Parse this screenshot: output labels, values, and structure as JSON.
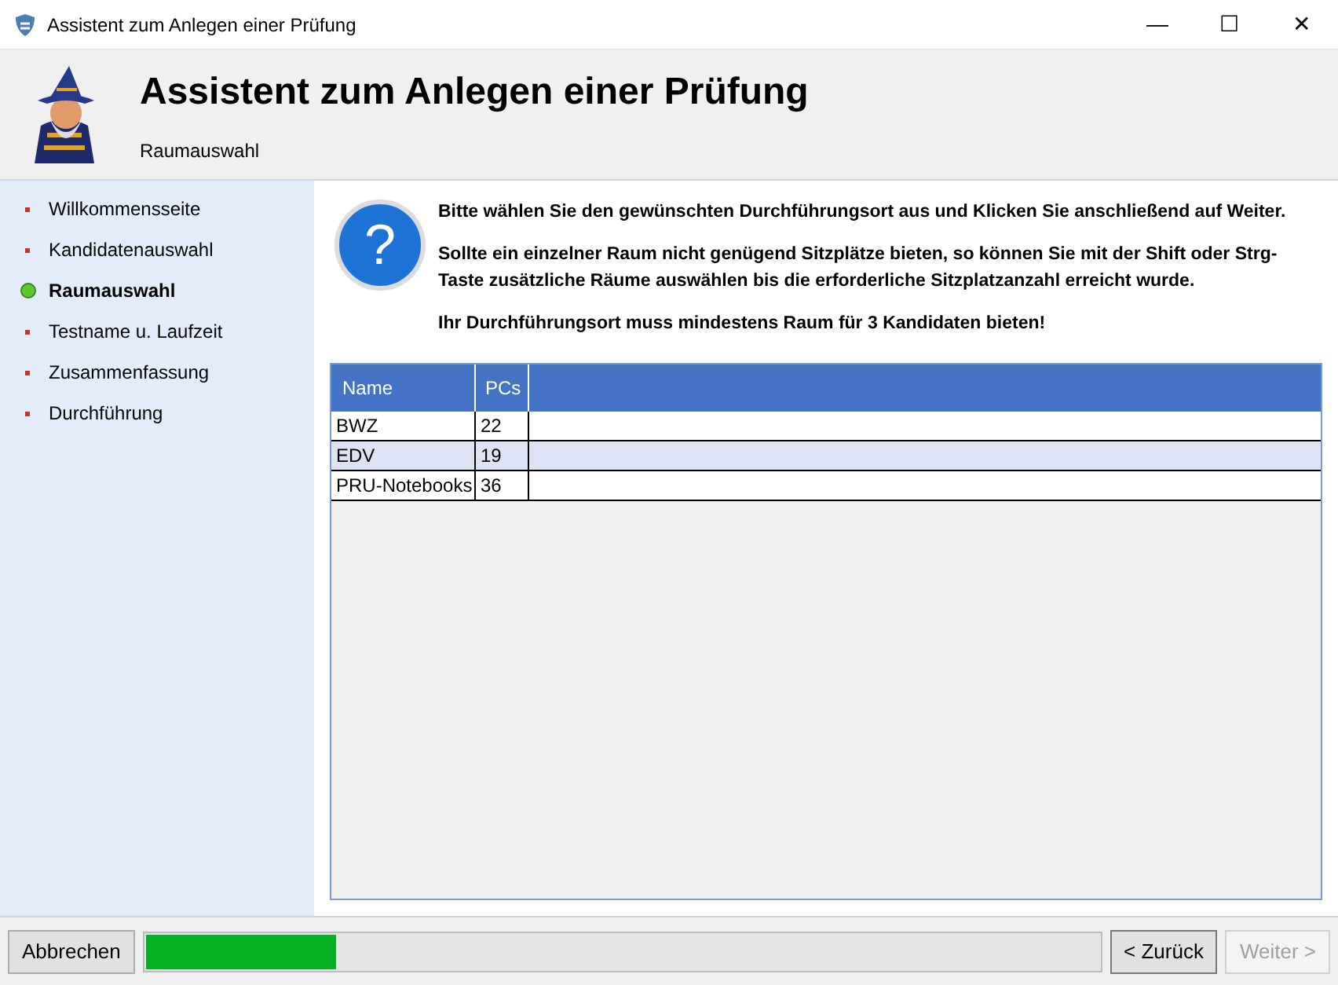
{
  "window": {
    "title": "Assistent zum Anlegen einer Prüfung",
    "controls": [
      "—",
      "☐",
      "✕"
    ]
  },
  "header": {
    "title": "Assistent zum Anlegen einer Prüfung",
    "subtitle": "Raumauswahl"
  },
  "steps": [
    {
      "label": "Willkommensseite",
      "selected": false
    },
    {
      "label": "Kandidatenauswahl",
      "selected": false
    },
    {
      "label": "Raumauswahl",
      "selected": true
    },
    {
      "label": "Testname u. Laufzeit",
      "selected": false
    },
    {
      "label": "Zusammenfassung",
      "selected": false
    },
    {
      "label": "Durchführung",
      "selected": false
    }
  ],
  "info": {
    "icon_text": "?",
    "paragraphs": [
      "Bitte wählen Sie den gewünschten Durchführungsort aus und Klicken Sie anschließend auf Weiter.",
      "Sollte ein einzelner Raum nicht genügend Sitzplätze bieten, so können Sie mit der Shift oder Strg-Taste zusätzliche Räume auswählen bis die erforderliche Sitzplatzanzahl erreicht wurde.",
      "Ihr Durchführungsort muss mindestens Raum für 3 Kandidaten bieten!"
    ]
  },
  "table": {
    "columns": [
      "Name",
      "PCs"
    ],
    "rows": [
      [
        "BWZ",
        "22"
      ],
      [
        "EDV",
        "19"
      ],
      [
        "PRU-Notebooks",
        "36"
      ]
    ]
  },
  "footer": {
    "cancel": "Abbrechen",
    "progress": {
      "level": 0.2
    },
    "back": {
      "label": "< Zurück",
      "disabled": false
    },
    "next": {
      "label": "Weiter >",
      "disabled": true
    }
  }
}
